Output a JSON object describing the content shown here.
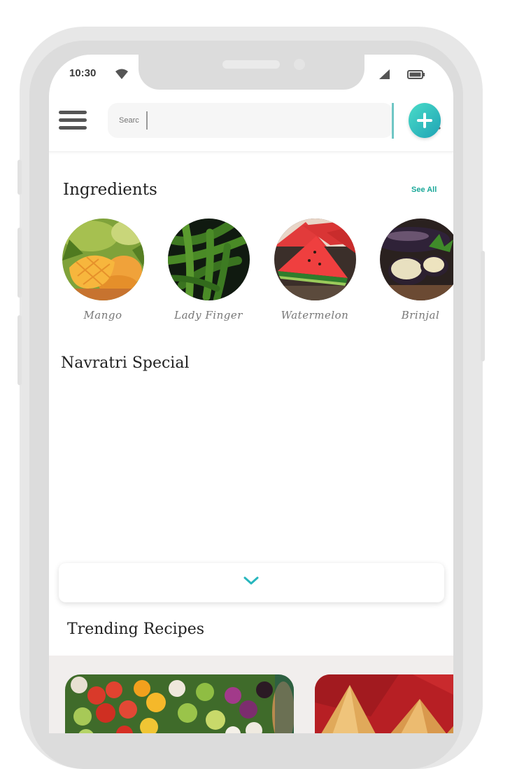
{
  "status_bar": {
    "time": "10:30"
  },
  "search": {
    "placeholder": "Searc"
  },
  "ingredients": {
    "title": "Ingredients",
    "see_all": "See All",
    "items": [
      {
        "label": "Mango"
      },
      {
        "label": "Lady Finger"
      },
      {
        "label": "Watermelon"
      },
      {
        "label": "Brinjal"
      }
    ]
  },
  "navratri": {
    "title": "Navratri Special"
  },
  "trending": {
    "title": "Trending Recipes"
  },
  "colors": {
    "accent": "#1fa3b5",
    "see_all": "#1aa899",
    "chevron": "#27b6bd"
  }
}
